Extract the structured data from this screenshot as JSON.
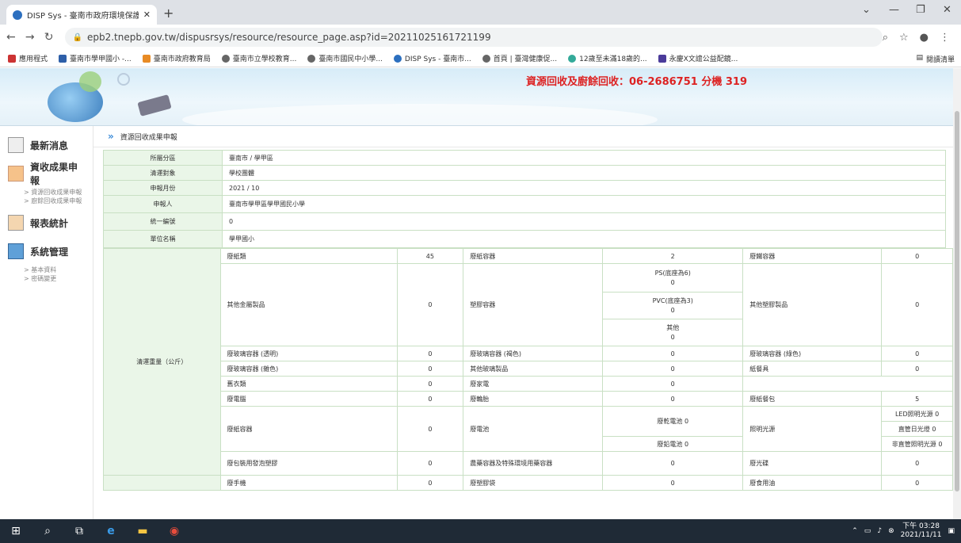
{
  "browser": {
    "tab_title": "DISP Sys - 臺南市政府環境保護局",
    "url": "epb2.tnepb.gov.tw/dispusrsys/resource/resource_page.asp?id=20211025161721199",
    "bookmarks": [
      {
        "label": "應用程式",
        "color": "#4a4a4a"
      },
      {
        "label": "臺南市學甲國小 -...",
        "color": "#2e5fa8"
      },
      {
        "label": "臺南市政府教育局",
        "color": "#e88b24"
      },
      {
        "label": "臺南市立學校教育...",
        "color": "#666"
      },
      {
        "label": "臺南市國民中小學...",
        "color": "#666"
      },
      {
        "label": "DISP Sys - 臺南市...",
        "color": "#2c6fbf"
      },
      {
        "label": "首頁 | 臺灣健康促...",
        "color": "#666"
      },
      {
        "label": "12歲至未滿18歲的...",
        "color": "#3a9"
      },
      {
        "label": "永慶X文誼公益配鏡...",
        "color": "#4b3b9a"
      }
    ],
    "reading_list": "閱讀清單"
  },
  "banner": {
    "hotline": "資源回收及廚餘回收：06-2686751 分機 319"
  },
  "sidebar": {
    "news": "最新消息",
    "report": "資收成果申報",
    "report_subs": [
      "資源回收成果申報",
      "廚餘回收成果申報"
    ],
    "stats": "報表統計",
    "system": "系統管理",
    "system_subs": [
      "基本資料",
      "密碼變更"
    ]
  },
  "breadcrumb": "資源回收成果申報",
  "info": [
    {
      "label": "所屬分區",
      "value": "臺南市 / 學甲區"
    },
    {
      "label": "清運對象",
      "value": "學校團體"
    },
    {
      "label": "申報月份",
      "value": "2021 / 10"
    },
    {
      "label": "申報人",
      "value": "臺南市學甲區學甲國民小學"
    },
    {
      "label": "統一編號",
      "value": "0"
    },
    {
      "label": "單位名稱",
      "value": "學甲國小"
    }
  ],
  "weights_label": "清運重量（公斤）",
  "items": {
    "waste_paper": {
      "label": "廢紙類",
      "value": "45"
    },
    "paper_container": {
      "label": "廢紙容器",
      "value": "2"
    },
    "iron_container": {
      "label": "廢鐵容器",
      "value": "0"
    },
    "other_metal": {
      "label": "其他金屬製品",
      "value": "0"
    },
    "plastic_container": {
      "label": "塑膠容器"
    },
    "ps": {
      "label": "PS(底座為6)",
      "value": "0"
    },
    "pvc": {
      "label": "PVC(底座為3)",
      "value": "0"
    },
    "plastic_other": {
      "label": "其他",
      "value": "0"
    },
    "other_plastic": {
      "label": "其他塑膠製品",
      "value": "0"
    },
    "glass_clear": {
      "label": "廢玻璃容器 (透明)",
      "value": "0"
    },
    "glass_brown": {
      "label": "廢玻璃容器 (褐色)",
      "value": "0"
    },
    "glass_green": {
      "label": "廢玻璃容器 (綠色)",
      "value": "0"
    },
    "glass_other": {
      "label": "廢玻璃容器 (雜色)",
      "value": "0"
    },
    "other_glass": {
      "label": "其他玻璃製品",
      "value": "0"
    },
    "paper_tableware": {
      "label": "紙餐具",
      "value": "0"
    },
    "clothes": {
      "label": "舊衣類",
      "value": "0"
    },
    "furniture": {
      "label": "廢家電",
      "value": "0"
    },
    "computer": {
      "label": "廢電腦",
      "value": "0"
    },
    "tires": {
      "label": "廢輪胎",
      "value": "0"
    },
    "paper_packs": {
      "label": "廢紙餐包",
      "value": "5"
    },
    "paper_cont2": {
      "label": "廢紙容器",
      "value": "0"
    },
    "battery": {
      "label": "廢電池"
    },
    "dry_battery": {
      "label": "廢乾電池 0"
    },
    "lead_battery": {
      "label": "廢鉛電池 0"
    },
    "lighting": {
      "label": "照明光源"
    },
    "led": {
      "label": "LED照明光源 0"
    },
    "straight_tube": {
      "label": "直管日光燈 0"
    },
    "non_straight": {
      "label": "非直管照明光源 0"
    },
    "foam": {
      "label": "廢包裝用發泡塑膠",
      "value": "0"
    },
    "pesticide": {
      "label": "農藥容器及特殊環境用藥容器",
      "value": "0"
    },
    "disc": {
      "label": "廢光碟",
      "value": "0"
    },
    "phone": {
      "label": "廢手機",
      "value": "0"
    },
    "plastic_bag": {
      "label": "廢塑膠袋",
      "value": "0"
    },
    "cooking_oil": {
      "label": "廢食用油",
      "value": "0"
    }
  },
  "taskbar": {
    "time": "下午 03:28",
    "date": "2021/11/11"
  }
}
